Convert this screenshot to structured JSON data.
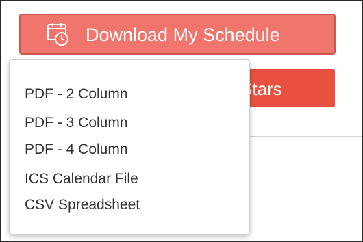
{
  "download_button": {
    "label": "Download My Schedule",
    "icon": "calendar-clock-icon"
  },
  "stars_button": {
    "label_visible": "Stars"
  },
  "dropdown": {
    "items": [
      "PDF - 2 Column",
      "PDF - 3 Column",
      "PDF - 4 Column",
      "ICS Calendar File",
      "CSV Spreadsheet"
    ]
  },
  "colors": {
    "download_bg": "#f0756c",
    "stars_bg": "#e8503f",
    "menu_text": "#333333"
  }
}
